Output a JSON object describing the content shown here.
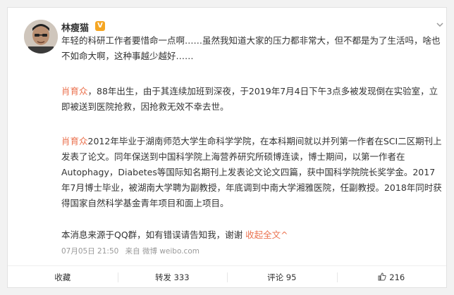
{
  "post": {
    "author": "林瘦猫",
    "verified_badge": "V",
    "paragraph1": "年轻的科研工作者要惜命一点啊……虽然我知道大家的压力都非常大，但不都是为了生活吗，啥也不如命大啊，这种事越少越好……",
    "p2_name": "肖育众",
    "p2_rest": "，88年出生，由于其连续加班到深夜，于2019年7月4日下午3点多被发现倒在实验室，立即被送到医院抢救，因抢救无效不幸去世。",
    "p3_name": "肖育众",
    "p3_rest": "2012年毕业于湖南师范大学生命科学学院，在本科期间就以并列第一作者在SCI二区期刊上发表了论文。同年保送到中国科学院上海营养研究所硕博连读，博士期间，以第一作者在Autophagy，Diabetes等国际知名期刊上发表论文论文四篇，获中国科学院院长奖学金。2017年7月博士毕业，被湖南大学聘为副教授，年底调到中南大学湘雅医院，任副教授。2018年同时获得国家自然科学基金青年项目和面上项目。",
    "p4_text": "本消息来源于QQ群，如有错误请告知我，谢谢 ",
    "p4_link": "收起全文^",
    "time": "07月05日 21:50",
    "source": "来自 微博 weibo.com"
  },
  "actions": {
    "favorite": "收藏",
    "repost": "转发 333",
    "comment": "评论 95",
    "like": "216"
  },
  "icons": {
    "chevron": "chevron-down-icon",
    "like": "thumbs-up-icon"
  }
}
